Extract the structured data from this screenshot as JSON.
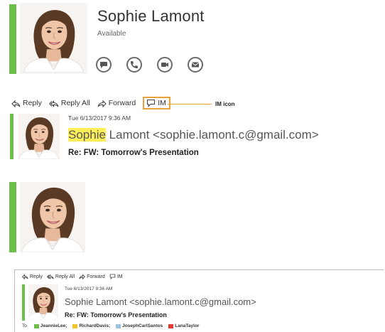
{
  "contact_card": {
    "name": "Sophie Lamont",
    "status": "Available",
    "presence_color": "#6cc04a",
    "actions": [
      {
        "name": "im-icon"
      },
      {
        "name": "phone-icon"
      },
      {
        "name": "video-icon"
      },
      {
        "name": "mail-icon"
      }
    ]
  },
  "toolbar": {
    "reply_label": "Reply",
    "reply_all_label": "Reply All",
    "forward_label": "Forward",
    "im_label": "IM",
    "highlight_color": "#e9a23b"
  },
  "callout": {
    "text": "IM icon"
  },
  "message": {
    "date": "Tue 6/13/2017 9:36 AM",
    "sender_first": "Sophie",
    "sender_rest": " Lamont <sophie.lamont.c@gmail.com>",
    "sender_full": "Sophie Lamont <sophie.lamont.c@gmail.com>",
    "subject": "Re: FW: Tomorrow's Presentation",
    "highlight_color": "#ffee58"
  },
  "recipients": {
    "to_label": "To",
    "list": [
      {
        "name": "JeannieLee;",
        "color": "#6cc04a"
      },
      {
        "name": "RichardDavis;",
        "color": "#f2c42c"
      },
      {
        "name": "JosephCarlSantos",
        "color": "#9fc3dc"
      },
      {
        "name": "LanaTaylor",
        "color": "#e53935"
      }
    ]
  }
}
